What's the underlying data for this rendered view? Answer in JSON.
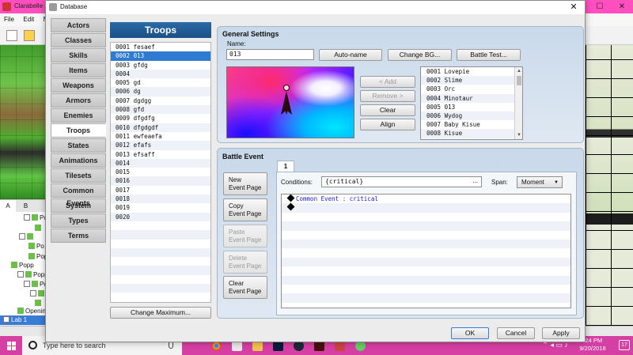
{
  "background_app": {
    "title": "Clarabelle - R",
    "menu": [
      "File",
      "Edit",
      "M"
    ],
    "map_tabs": [
      "A",
      "B"
    ],
    "tree_items": [
      "Pop",
      "Po",
      "Popp",
      "Popp",
      "Popp",
      "Po",
      "Openin",
      "Lab 1"
    ]
  },
  "taskbar": {
    "search_placeholder": "Type here to search",
    "time": "-24 PM",
    "date": "9/20/2018",
    "notifications": "17"
  },
  "dialog": {
    "title": "Database",
    "categories": [
      "Actors",
      "Classes",
      "Skills",
      "Items",
      "Weapons",
      "Armors",
      "Enemies",
      "Troops",
      "States",
      "Animations",
      "Tilesets",
      "Common Events",
      "System",
      "Types",
      "Terms"
    ],
    "active_category": "Troops",
    "troops": {
      "header": "Troops",
      "rows": [
        "0001 fesaef",
        "0002 013",
        "0003 gfdg",
        "0004",
        "0005 gd",
        "0006 dg",
        "0007 dgdgg",
        "0008 gfd",
        "0009 dfgdfg",
        "0010 dfgdgdf",
        "0011 ewfeaefa",
        "0012 efafs",
        "0013 efsaff",
        "0014",
        "0015",
        "0016",
        "0017",
        "0018",
        "0019",
        "0020"
      ],
      "selected": "0002 013",
      "change_max_label": "Change Maximum..."
    },
    "general": {
      "title": "General Settings",
      "name_label": "Name:",
      "name_value": "013",
      "autoname_label": "Auto-name",
      "change_bg_label": "Change BG...",
      "battle_test_label": "Battle Test...",
      "add_label": "< Add",
      "remove_label": "Remove >",
      "clear_label": "Clear",
      "align_label": "Align",
      "enemies": [
        "0001 Lovepie",
        "0002 Slime",
        "0003 Orc",
        "0004 Minotaur",
        "0005 013",
        "0006 Wydog",
        "0007 Baby Kisue",
        "0008 Kisue"
      ]
    },
    "battle_event": {
      "title": "Battle Event",
      "tab": "1",
      "conditions_label": "Conditions:",
      "conditions_value": "{critical}",
      "conditions_more": "...",
      "span_label": "Span:",
      "span_value": "Moment",
      "buttons": {
        "new": [
          "New",
          "Event Page"
        ],
        "copy": [
          "Copy",
          "Event Page"
        ],
        "paste": [
          "Paste",
          "Event Page"
        ],
        "delete": [
          "Delete",
          "Event Page"
        ],
        "clear": [
          "Clear",
          "Event Page"
        ]
      },
      "commands": [
        {
          "prefix": "Common Event",
          "sep": " : ",
          "value": "critical"
        },
        {
          "prefix": "",
          "sep": "",
          "value": ""
        }
      ]
    },
    "footer": {
      "ok": "OK",
      "cancel": "Cancel",
      "apply": "Apply"
    }
  }
}
